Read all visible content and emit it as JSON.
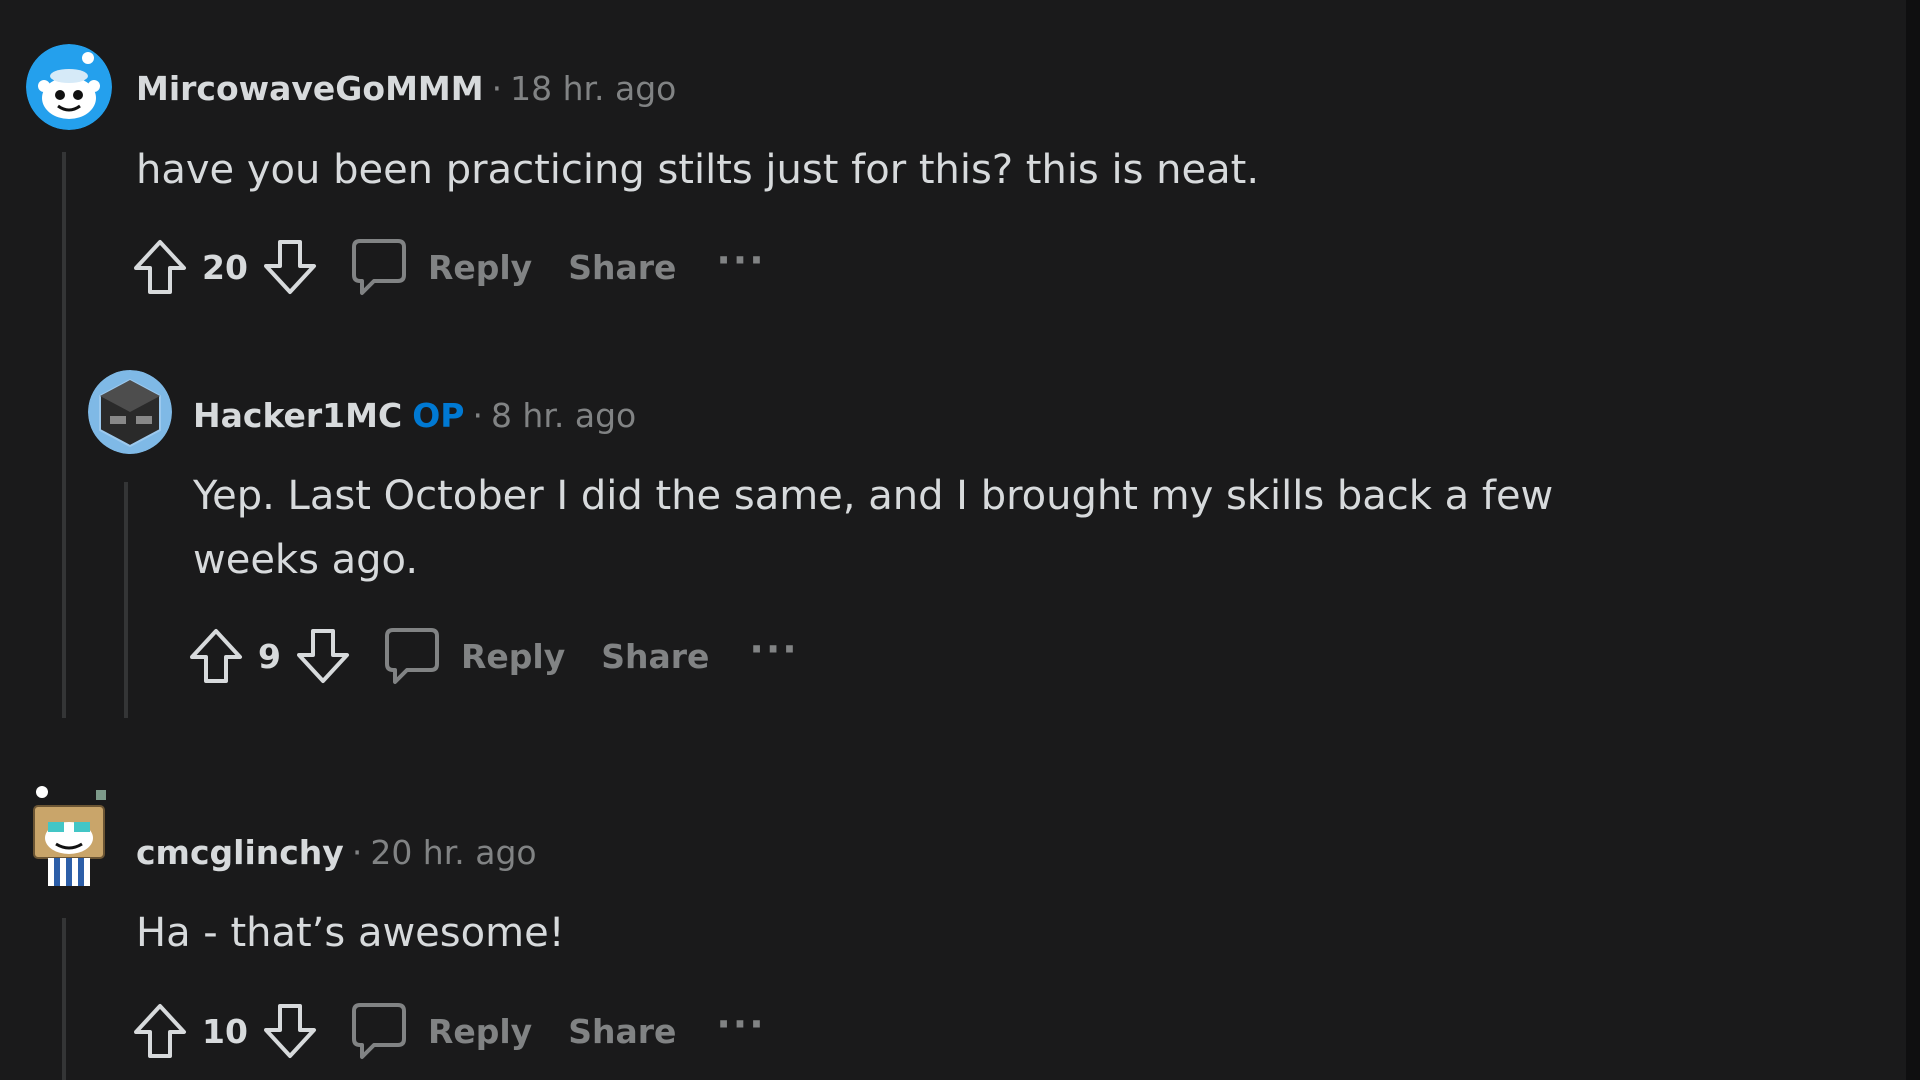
{
  "comments": [
    {
      "author": "MircowaveGoMMM",
      "time": "18 hr. ago",
      "body": "have you been practicing stilts just for this? this is neat.",
      "score": "20",
      "reply_label": "Reply",
      "share_label": "Share",
      "more_label": "···"
    },
    {
      "author": "Hacker1MC",
      "op_badge": "OP",
      "time": "8 hr. ago",
      "body": "Yep. Last October I did the same, and I brought my skills back a few weeks ago.",
      "score": "9",
      "reply_label": "Reply",
      "share_label": "Share",
      "more_label": "···"
    },
    {
      "author": "cmcglinchy",
      "time": "20 hr. ago",
      "body": "Ha - that’s awesome!",
      "score": "10",
      "reply_label": "Reply",
      "share_label": "Share",
      "more_label": "···"
    }
  ],
  "meta_separator": "·",
  "icons": {
    "upvote": "arrow-up-outline-icon",
    "downvote": "arrow-down-outline-icon",
    "reply": "speech-bubble-icon"
  },
  "colors": {
    "background": "#1a1a1b",
    "text": "#d7dadc",
    "muted": "#818384",
    "op": "#0079d3",
    "thread_line": "#343536"
  }
}
